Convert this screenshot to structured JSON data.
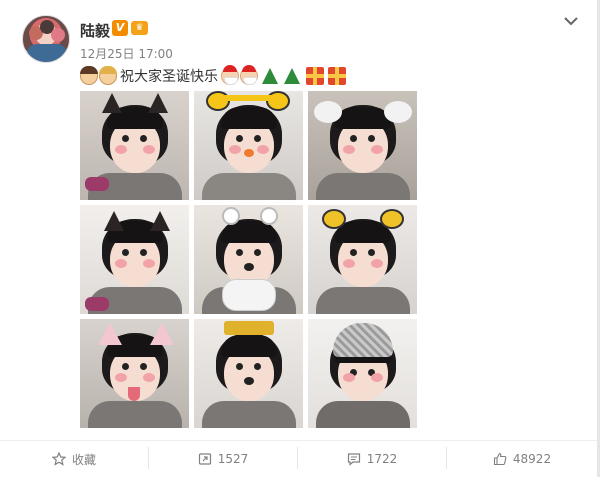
{
  "post": {
    "author": "陆毅",
    "verified_badge": "V",
    "level_badge": "♛",
    "time": "12月25日 17:00",
    "text": "祝大家圣诞快乐"
  },
  "emoji_before": [
    "face",
    "face"
  ],
  "emoji_after": [
    "santa",
    "santa",
    "tree",
    "tree",
    "gift",
    "gift"
  ],
  "photos": [
    {
      "filter": "black cat ears"
    },
    {
      "filter": "yellow ears"
    },
    {
      "filter": "white ears"
    },
    {
      "filter": "black cat ears"
    },
    {
      "filter": "mouse ears"
    },
    {
      "filter": "leopard ears"
    },
    {
      "filter": "pink cat ears"
    },
    {
      "filter": "crown"
    },
    {
      "filter": "helmet"
    }
  ],
  "actions": {
    "favorite": "收藏",
    "repost_count": "1527",
    "comment_count": "1722",
    "like_count": "48922"
  },
  "colors": {
    "verified": "#f38c00",
    "meta_text": "#808080",
    "divider": "#eeeeee"
  }
}
